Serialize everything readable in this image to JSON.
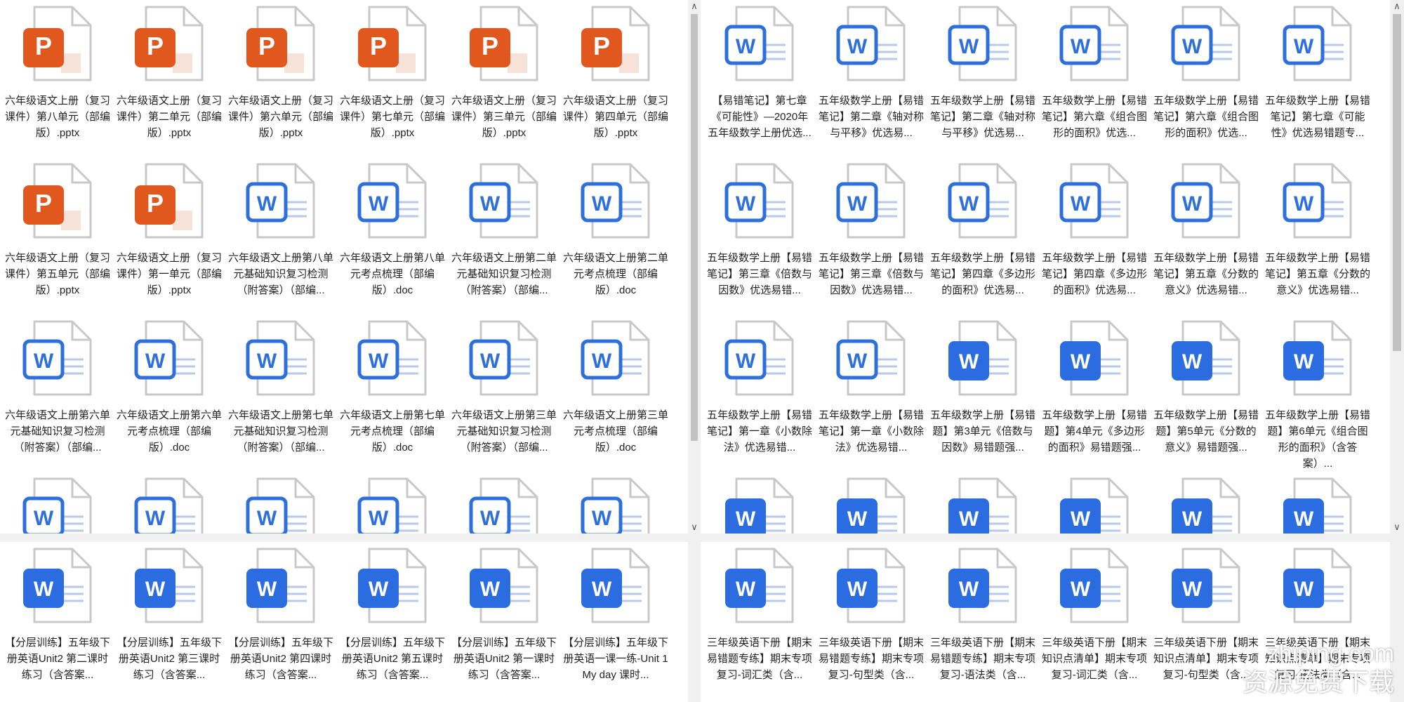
{
  "panes": [
    {
      "name": "left-pane",
      "items": [
        {
          "type": "pptx",
          "label": "六年级语文上册（复习课件）第八单元（部编版）.pptx"
        },
        {
          "type": "pptx",
          "label": "六年级语文上册（复习课件）第二单元（部编版）.pptx"
        },
        {
          "type": "pptx",
          "label": "六年级语文上册（复习课件）第六单元（部编版）.pptx"
        },
        {
          "type": "pptx",
          "label": "六年级语文上册（复习课件）第七单元（部编版）.pptx"
        },
        {
          "type": "pptx",
          "label": "六年级语文上册（复习课件）第三单元（部编版）.pptx"
        },
        {
          "type": "pptx",
          "label": "六年级语文上册（复习课件）第四单元（部编版）.pptx"
        },
        {
          "type": "pptx",
          "label": "六年级语文上册（复习课件）第五单元（部编版）.pptx"
        },
        {
          "type": "pptx",
          "label": "六年级语文上册（复习课件）第一单元（部编版）.pptx"
        },
        {
          "type": "doc",
          "label": "六年级语文上册第八单元基础知识复习检测（附答案）（部编..."
        },
        {
          "type": "doc",
          "label": "六年级语文上册第八单元考点梳理（部编版）.doc"
        },
        {
          "type": "doc",
          "label": "六年级语文上册第二单元基础知识复习检测（附答案）（部编..."
        },
        {
          "type": "doc",
          "label": "六年级语文上册第二单元考点梳理（部编版）.doc"
        },
        {
          "type": "doc",
          "label": "六年级语文上册第六单元基础知识复习检测（附答案）（部编..."
        },
        {
          "type": "doc",
          "label": "六年级语文上册第六单元考点梳理（部编版）.doc"
        },
        {
          "type": "doc",
          "label": "六年级语文上册第七单元基础知识复习检测（附答案）（部编..."
        },
        {
          "type": "doc",
          "label": "六年级语文上册第七单元考点梳理（部编版）.doc"
        },
        {
          "type": "doc",
          "label": "六年级语文上册第三单元基础知识复习检测（附答案）（部编..."
        },
        {
          "type": "doc",
          "label": "六年级语文上册第三单元考点梳理（部编版）.doc"
        },
        {
          "type": "doc",
          "label": ""
        },
        {
          "type": "doc",
          "label": ""
        },
        {
          "type": "doc",
          "label": ""
        },
        {
          "type": "doc",
          "label": ""
        },
        {
          "type": "doc",
          "label": ""
        },
        {
          "type": "doc",
          "label": ""
        }
      ]
    },
    {
      "name": "right-pane",
      "items": [
        {
          "type": "doc",
          "label": "【易错笔记】第七章《可能性》—2020年五年级数学上册优选..."
        },
        {
          "type": "doc",
          "label": "五年级数学上册【易错笔记】第二章《轴对称与平移》优选易..."
        },
        {
          "type": "doc",
          "label": "五年级数学上册【易错笔记】第二章《轴对称与平移》优选易..."
        },
        {
          "type": "doc",
          "label": "五年级数学上册【易错笔记】第六章《组合图形的面积》优选..."
        },
        {
          "type": "doc",
          "label": "五年级数学上册【易错笔记】第六章《组合图形的面积》优选..."
        },
        {
          "type": "doc",
          "label": "五年级数学上册【易错笔记】第七章《可能性》优选易错题专..."
        },
        {
          "type": "doc",
          "label": "五年级数学上册【易错笔记】第三章《倍数与因数》优选易错..."
        },
        {
          "type": "doc",
          "label": "五年级数学上册【易错笔记】第三章《倍数与因数》优选易错..."
        },
        {
          "type": "doc",
          "label": "五年级数学上册【易错笔记】第四章《多边形的面积》优选易..."
        },
        {
          "type": "doc",
          "label": "五年级数学上册【易错笔记】第四章《多边形的面积》优选易..."
        },
        {
          "type": "doc",
          "label": "五年级数学上册【易错笔记】第五章《分数的意义》优选易错..."
        },
        {
          "type": "doc",
          "label": "五年级数学上册【易错笔记】第五章《分数的意义》优选易错..."
        },
        {
          "type": "doc",
          "label": "五年级数学上册【易错笔记】第一章《小数除法》优选易错..."
        },
        {
          "type": "doc",
          "label": "五年级数学上册【易错笔记】第一章《小数除法》优选易错..."
        },
        {
          "type": "docx",
          "label": "五年级数学上册【易错题】第3单元《倍数与因数》易错题强..."
        },
        {
          "type": "docx",
          "label": "五年级数学上册【易错题】第4单元《多边形的面积》易错题强..."
        },
        {
          "type": "docx",
          "label": "五年级数学上册【易错题】第5单元《分数的意义》易错题强..."
        },
        {
          "type": "docx",
          "label": "五年级数学上册【易错题】第6单元《组合图形的面积》（含答案）..."
        },
        {
          "type": "docx",
          "label": ""
        },
        {
          "type": "docx",
          "label": ""
        },
        {
          "type": "docx",
          "label": ""
        },
        {
          "type": "docx",
          "label": ""
        },
        {
          "type": "docx",
          "label": ""
        },
        {
          "type": "docx",
          "label": ""
        }
      ]
    },
    {
      "name": "bottom-left-pane",
      "items": [
        {
          "type": "docx",
          "label": "【分层训练】五年级下册英语Unit2 第二课时练习（含答案..."
        },
        {
          "type": "docx",
          "label": "【分层训练】五年级下册英语Unit2 第三课时练习（含答案..."
        },
        {
          "type": "docx",
          "label": "【分层训练】五年级下册英语Unit2 第四课时练习（含答案..."
        },
        {
          "type": "docx",
          "label": "【分层训练】五年级下册英语Unit2 第五课时练习（含答案..."
        },
        {
          "type": "docx",
          "label": "【分层训练】五年级下册英语Unit2 第一课时练习（含答案..."
        },
        {
          "type": "docx",
          "label": "【分层训练】五年级下册英语一课一练-Unit 1 My day 课时..."
        }
      ]
    },
    {
      "name": "bottom-right-pane",
      "items": [
        {
          "type": "docx",
          "label": "三年级英语下册【期末易错题专练】期末专项复习-词汇类（含..."
        },
        {
          "type": "docx",
          "label": "三年级英语下册【期末易错题专练】期末专项复习-句型类（含..."
        },
        {
          "type": "docx",
          "label": "三年级英语下册【期末易错题专练】期末专项复习-语法类（含..."
        },
        {
          "type": "docx",
          "label": "三年级英语下册【期末知识点清单】期末专项复习-词汇类（含..."
        },
        {
          "type": "docx",
          "label": "三年级英语下册【期末知识点清单】期末专项复习-句型类（含..."
        },
        {
          "type": "docx",
          "label": "三年级英语下册【期末知识点清单】期末专项复习-语法类（含..."
        }
      ]
    }
  ],
  "scroll_arrows": {
    "up": "∧",
    "down": "∨"
  },
  "watermark": {
    "line1": "zhiping.com",
    "line2": "资源免费下载"
  },
  "colors": {
    "ppt_orange": "#e0581d",
    "word_blue": "#2b6de0",
    "word_outline_blue": "#2f6fdc",
    "page_grey": "#c8c8c8"
  }
}
